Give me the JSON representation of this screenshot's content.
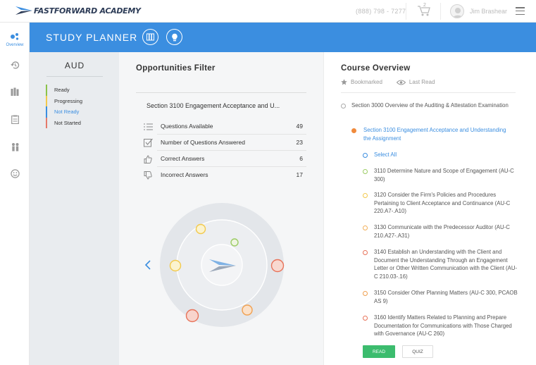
{
  "header": {
    "brand": "FASTFORWARD ACADEMY",
    "phone": "(888) 798 - 7277",
    "cart_count": "2",
    "user_name": "Jim Brashear"
  },
  "leftnav": {
    "items": [
      {
        "label": "Overview",
        "icon": "overview-icon"
      },
      {
        "label": "",
        "icon": "history-icon"
      },
      {
        "label": "",
        "icon": "books-icon"
      },
      {
        "label": "",
        "icon": "clipboard-icon"
      },
      {
        "label": "",
        "icon": "people-icon"
      },
      {
        "label": "",
        "icon": "smiley-icon"
      }
    ]
  },
  "banner": {
    "title": "STUDY PLANNER",
    "icons": [
      "study-guide-icon",
      "tips-icon"
    ],
    "color": "#3b8ee0"
  },
  "subject": {
    "title": "AUD",
    "legend": [
      {
        "label": "Ready",
        "color": "#8bc34a"
      },
      {
        "label": "Progressing",
        "color": "#f2c94c"
      },
      {
        "label": "Not Ready",
        "color": "#3b8ee0"
      },
      {
        "label": "Not Started",
        "color": "#e57a6b"
      }
    ]
  },
  "filter": {
    "title": "Opportunities Filter",
    "section": "Section 3100 Engagement Acceptance and U...",
    "stats": [
      {
        "label": "Questions Available",
        "value": "49",
        "icon": "list-icon"
      },
      {
        "label": "Number of Questions Answered",
        "value": "23",
        "icon": "checkbox-icon"
      },
      {
        "label": "Correct Answers",
        "value": "6",
        "icon": "thumbs-up-icon"
      },
      {
        "label": "Incorrect Answers",
        "value": "17",
        "icon": "thumbs-down-icon"
      }
    ]
  },
  "course": {
    "title": "Course Overview",
    "bookmarked": "Bookmarked",
    "last_read": "Last Read",
    "items": [
      {
        "text": "Section 3000 Overview of the Auditing & Attestation Examination",
        "color": "#aaaaaa",
        "fill": false
      },
      {
        "text": "Section 3100 Engagement Acceptance and Understanding the Assignment",
        "color": "#f08a3c",
        "fill": true,
        "active": true
      },
      {
        "text": "Select All",
        "color": "#3b8ee0",
        "fill": false,
        "active": true
      },
      {
        "text": "3110 Determine Nature and Scope of Engagement (AU-C 300)",
        "color": "#9ccc65",
        "fill": false
      },
      {
        "text": "3120 Consider the Firm's Policies and Procedures Pertaining to Client Acceptance and Continuance (AU-C 220.A7-.A10)",
        "color": "#f2c94c",
        "fill": false
      },
      {
        "text": "3130 Communicate with the Predecessor Auditor (AU-C 210.A27-.A31)",
        "color": "#f2b05a",
        "fill": false
      },
      {
        "text": "3140 Establish an Understanding with the Client and Document the Understanding Through an Engagement Letter or Other Written Communication with the Client (AU-C 210.03-.16)",
        "color": "#e8735a",
        "fill": false
      },
      {
        "text": "3150 Consider Other Planning Matters (AU-C 300, PCAOB AS 9)",
        "color": "#f0a050",
        "fill": false
      },
      {
        "text": "3160 Identify Matters Related to Planning and Prepare Documentation for Communications with Those Charged with Governance (AU-C 260)",
        "color": "#e8735a",
        "fill": false
      }
    ],
    "read_label": "READ",
    "quiz_label": "QUIZ"
  }
}
